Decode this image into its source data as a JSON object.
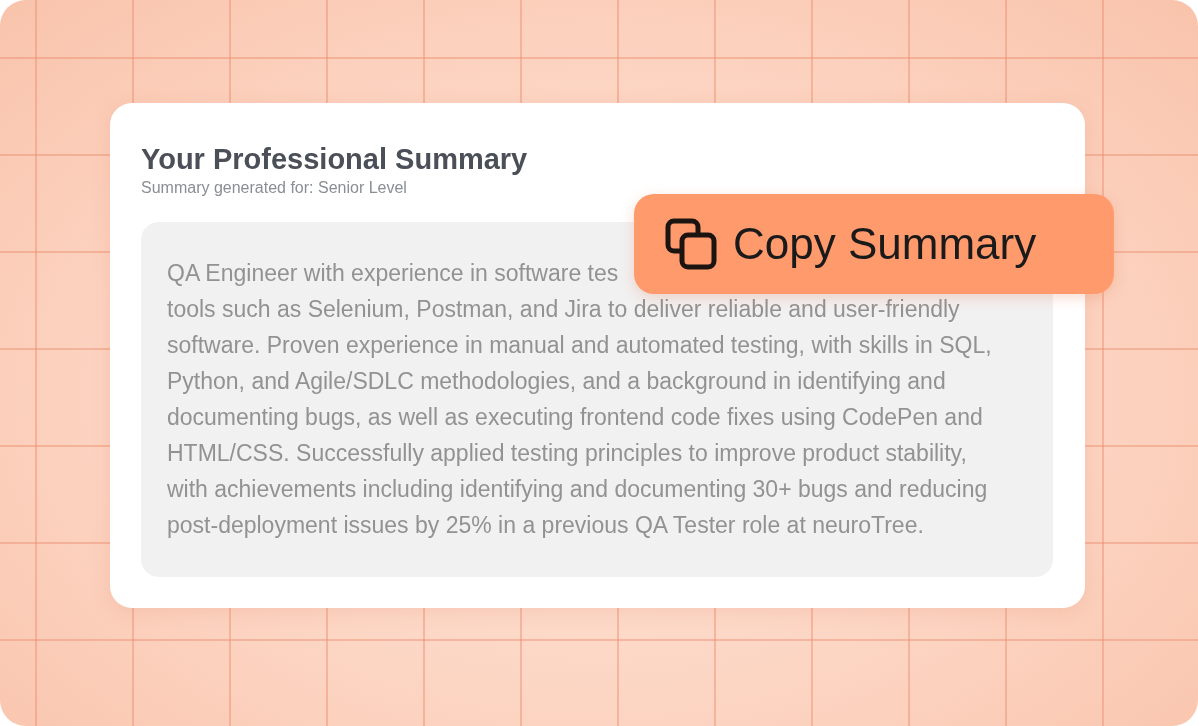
{
  "card": {
    "title": "Your Professional Summary",
    "subtitle": "Summary generated for: Senior Level",
    "summary_lines": [
      "QA Engineer with experience in software tes",
      "tools such as Selenium, Postman, and Jira to deliver reliable and user-friendly",
      "software. Proven experience in manual and automated testing, with skills in SQL,",
      "Python, and Agile/SDLC methodologies, and a background in identifying and",
      "documenting bugs, as well as executing frontend code fixes using CodePen and",
      "HTML/CSS. Successfully applied testing principles to improve product stability,",
      "with achievements including identifying and documenting 30+ bugs and reducing",
      "post-deployment issues by 25% in a previous QA Tester role at neuroTree."
    ]
  },
  "copy_button": {
    "label": "Copy Summary"
  }
}
